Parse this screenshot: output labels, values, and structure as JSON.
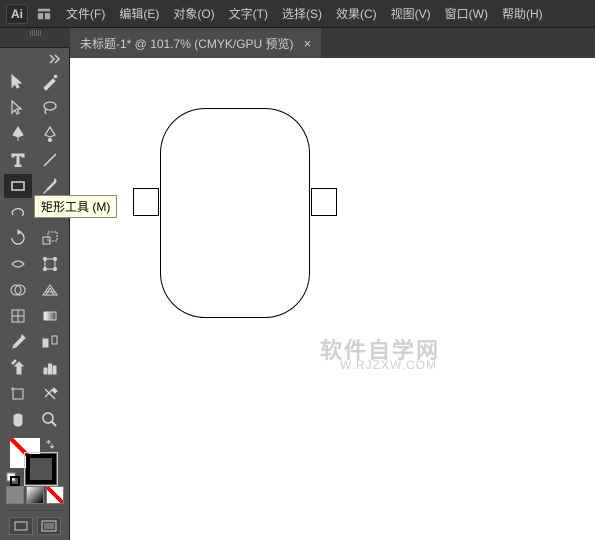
{
  "app": {
    "logo_text": "Ai"
  },
  "menu": {
    "file": "文件(F)",
    "edit": "编辑(E)",
    "object": "对象(O)",
    "type": "文字(T)",
    "select": "选择(S)",
    "effect": "效果(C)",
    "view": "视图(V)",
    "window": "窗口(W)",
    "help": "帮助(H)"
  },
  "doc_tab": {
    "title": "未标题-1* @ 101.7%  (CMYK/GPU 预览)",
    "close": "×"
  },
  "tooltip": {
    "rectangle": "矩形工具 (M)"
  },
  "watermark": {
    "line1": "软件自学网",
    "line2": "W.RJZXW.COM"
  }
}
